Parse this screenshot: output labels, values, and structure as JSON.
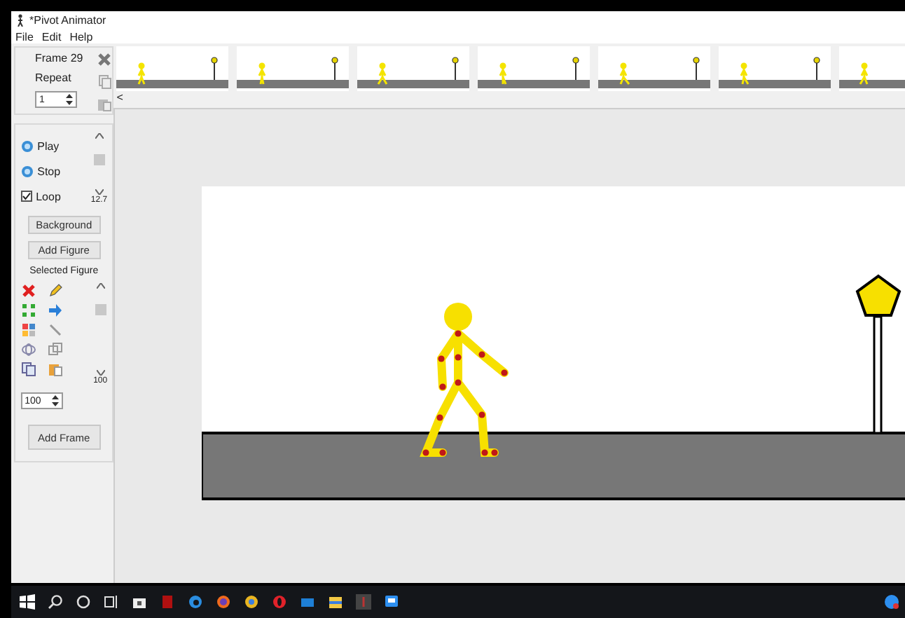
{
  "window": {
    "title": "*Pivot Animator"
  },
  "menu": [
    "File",
    "Edit",
    "Help"
  ],
  "frame_panel": {
    "frame_label": "Frame 29",
    "repeat_label": "Repeat",
    "repeat_value": "1"
  },
  "timeline": {
    "scroll_left": "<"
  },
  "playback": {
    "play": "Play",
    "stop": "Stop",
    "loop": {
      "label": "Loop",
      "checked": true
    },
    "speed": {
      "level": 0.8,
      "reading": "12.7"
    }
  },
  "buttons": {
    "background": "Background",
    "add_figure": "Add Figure"
  },
  "selected_figure": {
    "label": "Selected Figure",
    "scale_value": "100",
    "scale": {
      "level": 0.9,
      "reading": "100"
    }
  },
  "add_frame": "Add Frame"
}
